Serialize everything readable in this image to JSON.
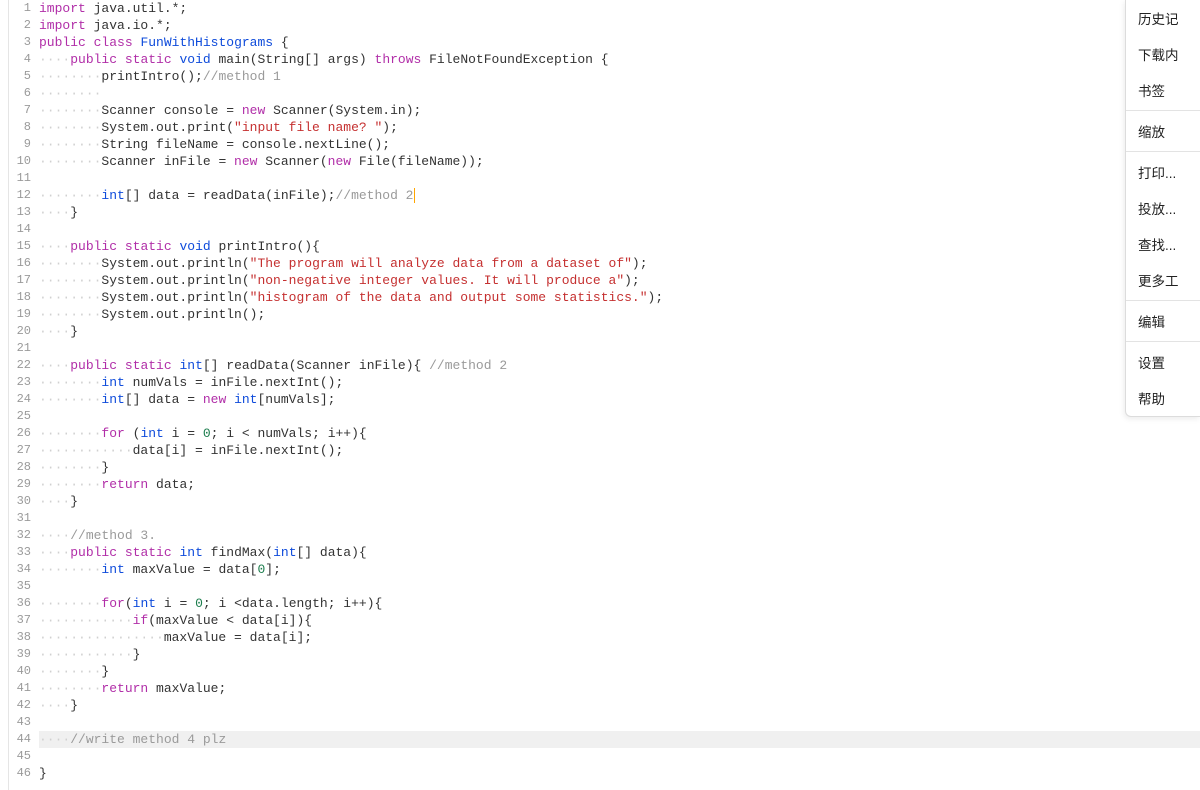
{
  "menu": {
    "items": [
      "历史记",
      "下载内",
      "书签",
      "缩放",
      "打印...",
      "投放...",
      "查找...",
      "更多工",
      "编辑",
      "设置",
      "帮助"
    ],
    "separators_after": [
      2,
      3,
      7,
      8
    ]
  },
  "code": {
    "lines": [
      {
        "n": 1,
        "segs": [
          [
            "kw",
            "import"
          ],
          [
            "def",
            " java.util.*;"
          ]
        ]
      },
      {
        "n": 2,
        "segs": [
          [
            "kw",
            "import"
          ],
          [
            "def",
            " java.io.*;"
          ]
        ]
      },
      {
        "n": 3,
        "segs": [
          [
            "kw",
            "public"
          ],
          [
            "def",
            " "
          ],
          [
            "kw",
            "class"
          ],
          [
            "def",
            " "
          ],
          [
            "kw2",
            "FunWithHistograms"
          ],
          [
            "def",
            " {"
          ]
        ]
      },
      {
        "n": 4,
        "indent": 4,
        "segs": [
          [
            "kw",
            "public"
          ],
          [
            "def",
            " "
          ],
          [
            "kw",
            "static"
          ],
          [
            "def",
            " "
          ],
          [
            "kw2",
            "void"
          ],
          [
            "def",
            " main(String[] args) "
          ],
          [
            "kw",
            "throws"
          ],
          [
            "def",
            " FileNotFoundException {"
          ]
        ]
      },
      {
        "n": 5,
        "indent": 8,
        "segs": [
          [
            "def",
            "printIntro();"
          ],
          [
            "com",
            "//method 1"
          ]
        ]
      },
      {
        "n": 6,
        "indent": 8,
        "segs": []
      },
      {
        "n": 7,
        "indent": 8,
        "segs": [
          [
            "def",
            "Scanner console = "
          ],
          [
            "kw",
            "new"
          ],
          [
            "def",
            " Scanner(System.in);"
          ]
        ]
      },
      {
        "n": 8,
        "indent": 8,
        "segs": [
          [
            "def",
            "System.out.print("
          ],
          [
            "str",
            "\"input file name? \""
          ],
          [
            "def",
            ");"
          ]
        ]
      },
      {
        "n": 9,
        "indent": 8,
        "segs": [
          [
            "def",
            "String fileName = console.nextLine();"
          ]
        ]
      },
      {
        "n": 10,
        "indent": 8,
        "segs": [
          [
            "def",
            "Scanner inFile = "
          ],
          [
            "kw",
            "new"
          ],
          [
            "def",
            " Scanner("
          ],
          [
            "kw",
            "new"
          ],
          [
            "def",
            " File(fileName));"
          ]
        ]
      },
      {
        "n": 11,
        "segs": []
      },
      {
        "n": 12,
        "indent": 8,
        "segs": [
          [
            "kw2",
            "int"
          ],
          [
            "def",
            "[] data = readData(inFile);"
          ],
          [
            "com",
            "//method 2"
          ]
        ],
        "cursor": true
      },
      {
        "n": 13,
        "indent": 4,
        "segs": [
          [
            "def",
            "}"
          ]
        ]
      },
      {
        "n": 14,
        "segs": []
      },
      {
        "n": 15,
        "indent": 4,
        "segs": [
          [
            "kw",
            "public"
          ],
          [
            "def",
            " "
          ],
          [
            "kw",
            "static"
          ],
          [
            "def",
            " "
          ],
          [
            "kw2",
            "void"
          ],
          [
            "def",
            " printIntro(){"
          ]
        ]
      },
      {
        "n": 16,
        "indent": 8,
        "segs": [
          [
            "def",
            "System.out.println("
          ],
          [
            "str",
            "\"The program will analyze data from a dataset of\""
          ],
          [
            "def",
            ");"
          ]
        ]
      },
      {
        "n": 17,
        "indent": 8,
        "segs": [
          [
            "def",
            "System.out.println("
          ],
          [
            "str",
            "\"non-negative integer values. It will produce a\""
          ],
          [
            "def",
            ");"
          ]
        ]
      },
      {
        "n": 18,
        "indent": 8,
        "segs": [
          [
            "def",
            "System.out.println("
          ],
          [
            "str",
            "\"histogram of the data and output some statistics.\""
          ],
          [
            "def",
            ");"
          ]
        ]
      },
      {
        "n": 19,
        "indent": 8,
        "segs": [
          [
            "def",
            "System.out.println();"
          ]
        ]
      },
      {
        "n": 20,
        "indent": 4,
        "segs": [
          [
            "def",
            "}"
          ]
        ]
      },
      {
        "n": 21,
        "segs": []
      },
      {
        "n": 22,
        "indent": 4,
        "segs": [
          [
            "kw",
            "public"
          ],
          [
            "def",
            " "
          ],
          [
            "kw",
            "static"
          ],
          [
            "def",
            " "
          ],
          [
            "kw2",
            "int"
          ],
          [
            "def",
            "[] readData(Scanner inFile){ "
          ],
          [
            "com",
            "//method 2"
          ]
        ]
      },
      {
        "n": 23,
        "indent": 8,
        "segs": [
          [
            "kw2",
            "int"
          ],
          [
            "def",
            " numVals = inFile.nextInt();"
          ]
        ]
      },
      {
        "n": 24,
        "indent": 8,
        "segs": [
          [
            "kw2",
            "int"
          ],
          [
            "def",
            "[] data = "
          ],
          [
            "kw",
            "new"
          ],
          [
            "def",
            " "
          ],
          [
            "kw2",
            "int"
          ],
          [
            "def",
            "[numVals];"
          ]
        ]
      },
      {
        "n": 25,
        "segs": []
      },
      {
        "n": 26,
        "indent": 8,
        "segs": [
          [
            "kw",
            "for"
          ],
          [
            "def",
            " ("
          ],
          [
            "kw2",
            "int"
          ],
          [
            "def",
            " i = "
          ],
          [
            "num",
            "0"
          ],
          [
            "def",
            "; i < numVals; i++){"
          ]
        ]
      },
      {
        "n": 27,
        "indent": 12,
        "segs": [
          [
            "def",
            "data[i] = inFile.nextInt();"
          ]
        ]
      },
      {
        "n": 28,
        "indent": 8,
        "segs": [
          [
            "def",
            "}"
          ]
        ]
      },
      {
        "n": 29,
        "indent": 8,
        "segs": [
          [
            "kw",
            "return"
          ],
          [
            "def",
            " data;"
          ]
        ]
      },
      {
        "n": 30,
        "indent": 4,
        "segs": [
          [
            "def",
            "}"
          ]
        ]
      },
      {
        "n": 31,
        "segs": []
      },
      {
        "n": 32,
        "indent": 4,
        "segs": [
          [
            "com",
            "//method 3."
          ]
        ]
      },
      {
        "n": 33,
        "indent": 4,
        "segs": [
          [
            "kw",
            "public"
          ],
          [
            "def",
            " "
          ],
          [
            "kw",
            "static"
          ],
          [
            "def",
            " "
          ],
          [
            "kw2",
            "int"
          ],
          [
            "def",
            " findMax("
          ],
          [
            "kw2",
            "int"
          ],
          [
            "def",
            "[] data){"
          ]
        ]
      },
      {
        "n": 34,
        "indent": 8,
        "segs": [
          [
            "kw2",
            "int"
          ],
          [
            "def",
            " maxValue = data["
          ],
          [
            "num",
            "0"
          ],
          [
            "def",
            "];"
          ]
        ]
      },
      {
        "n": 35,
        "segs": []
      },
      {
        "n": 36,
        "indent": 8,
        "segs": [
          [
            "kw",
            "for"
          ],
          [
            "def",
            "("
          ],
          [
            "kw2",
            "int"
          ],
          [
            "def",
            " i = "
          ],
          [
            "num",
            "0"
          ],
          [
            "def",
            "; i <data.length; i++){"
          ]
        ]
      },
      {
        "n": 37,
        "indent": 12,
        "segs": [
          [
            "kw",
            "if"
          ],
          [
            "def",
            "(maxValue < data[i]){"
          ]
        ]
      },
      {
        "n": 38,
        "indent": 16,
        "segs": [
          [
            "def",
            "maxValue = data[i];"
          ]
        ]
      },
      {
        "n": 39,
        "indent": 12,
        "segs": [
          [
            "def",
            "}"
          ]
        ]
      },
      {
        "n": 40,
        "indent": 8,
        "segs": [
          [
            "def",
            "}"
          ]
        ]
      },
      {
        "n": 41,
        "indent": 8,
        "segs": [
          [
            "kw",
            "return"
          ],
          [
            "def",
            " maxValue;"
          ]
        ]
      },
      {
        "n": 42,
        "indent": 4,
        "segs": [
          [
            "def",
            "}"
          ]
        ]
      },
      {
        "n": 43,
        "segs": []
      },
      {
        "n": 44,
        "indent": 4,
        "active": true,
        "segs": [
          [
            "com",
            "//write method 4 plz"
          ]
        ]
      },
      {
        "n": 45,
        "segs": []
      },
      {
        "n": 46,
        "segs": [
          [
            "def",
            "}"
          ]
        ]
      }
    ]
  }
}
